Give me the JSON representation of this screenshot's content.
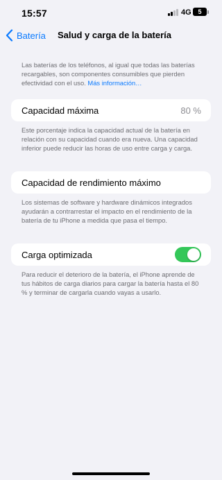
{
  "status_bar": {
    "time": "15:57",
    "network": "4G",
    "battery_level": "5",
    "signal_icon": "cellular-signal-icon"
  },
  "nav": {
    "back_label": "Batería",
    "back_icon": "chevron-left-icon",
    "title": "Salud y carga de la batería"
  },
  "intro": {
    "text": "Las baterías de los teléfonos, al igual que todas las baterías recargables, son componentes consumibles que pierden efectividad con el uso.",
    "link": "Más información…"
  },
  "max_capacity": {
    "label": "Capacidad máxima",
    "value": "80 %",
    "description": "Este porcentaje indica la capacidad actual de la batería en relación con su capacidad cuando era nueva. Una capacidad inferior puede reducir las horas de uso entre carga y carga."
  },
  "peak_performance": {
    "label": "Capacidad de rendimiento máximo",
    "description": "Los sistemas de software y hardware dinámicos integrados ayudarán a contrarrestar el impacto en el rendimiento de la batería de tu iPhone a medida que pasa el tiempo."
  },
  "optimized_charging": {
    "label": "Carga optimizada",
    "enabled": true,
    "toggle_color": "#34c759",
    "description": "Para reducir el deterioro de la batería, el iPhone aprende de tus hábitos de carga diarios para cargar la batería hasta el 80 % y terminar de cargarla cuando vayas a usarlo."
  },
  "colors": {
    "accent": "#0a7aff",
    "background": "#f2f2f7",
    "secondary_text": "#6d6d72"
  }
}
